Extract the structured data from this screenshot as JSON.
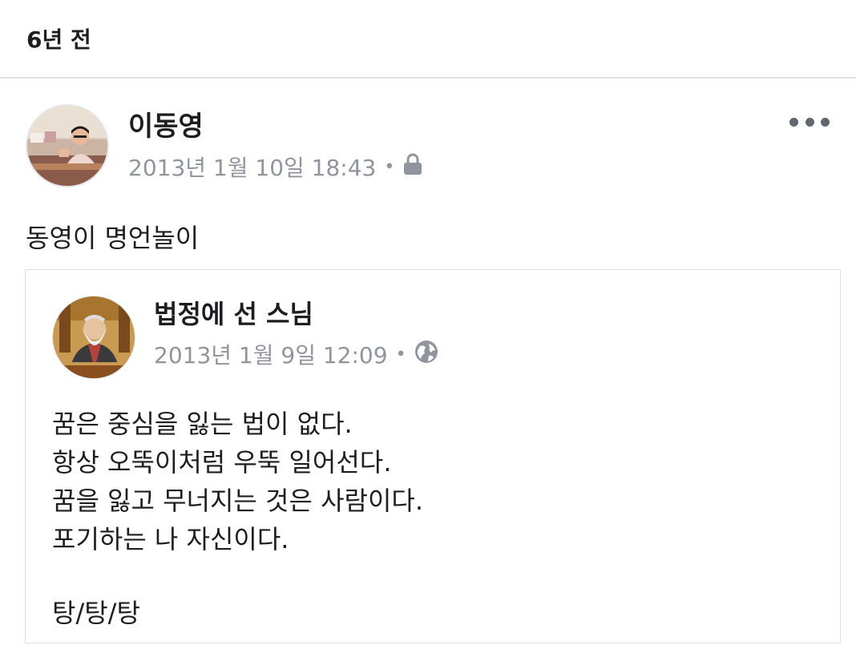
{
  "memory": {
    "label": "6년 전"
  },
  "post": {
    "author": "이동영",
    "timestamp": "2013년 1월 10일 18:43",
    "separator": "•",
    "privacy_icon": "lock-icon",
    "more_icon": "more-options-icon",
    "text": "동영이 명언놀이"
  },
  "shared": {
    "author": "법정에 선 스님",
    "timestamp": "2013년 1월 9일 12:09",
    "separator": "•",
    "privacy_icon": "globe-icon",
    "lines": [
      "꿈은 중심을 잃는 법이 없다.",
      "항상 오뚝이처럼 우뚝 일어선다.",
      "꿈을 잃고 무너지는 것은 사람이다.",
      "포기하는 나 자신이다."
    ],
    "signoff": "탕/탕/탕"
  },
  "colors": {
    "text": "#1c1e21",
    "meta": "#90949c",
    "border": "#dddfe2"
  }
}
